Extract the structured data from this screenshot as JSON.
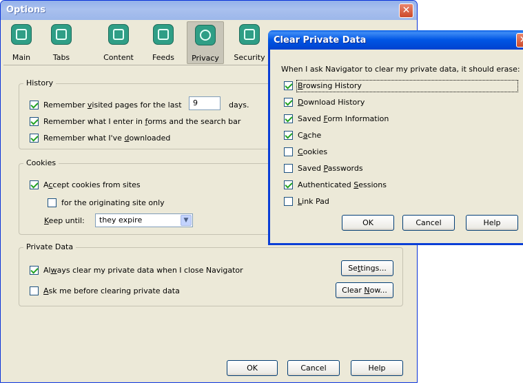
{
  "options": {
    "title": "Options",
    "toolbar": [
      {
        "label": "Main",
        "icon": "main-icon"
      },
      {
        "label": "Tabs",
        "icon": "tabs-icon"
      },
      {
        "label": "Content",
        "icon": "content-icon"
      },
      {
        "label": "Feeds",
        "icon": "feeds-icon"
      },
      {
        "label": "Privacy",
        "icon": "privacy-icon",
        "selected": true
      },
      {
        "label": "Security",
        "icon": "security-icon"
      }
    ],
    "history": {
      "legend": "History",
      "remember_visited_pre": "Remember ",
      "remember_visited_u": "v",
      "remember_visited_post": "isited pages for the last",
      "days_value": "9",
      "days_label": "days.",
      "remember_forms_pre": "Remember what I enter in ",
      "remember_forms_u": "f",
      "remember_forms_post": "orms and the search bar",
      "remember_downloads_pre": "Remember what I've ",
      "remember_downloads_u": "d",
      "remember_downloads_post": "ownloaded"
    },
    "cookies": {
      "legend": "Cookies",
      "accept_pre": "A",
      "accept_u": "c",
      "accept_post": "cept cookies from sites",
      "originating": "for the originating site only",
      "keep_until_u": "K",
      "keep_until_post": "eep until:",
      "keep_until_value": "they expire"
    },
    "private_data": {
      "legend": "Private Data",
      "always_clear_pre": "Al",
      "always_clear_u": "w",
      "always_clear_post": "ays clear my private data when I close Navigator",
      "ask_u": "A",
      "ask_post": "sk me before clearing private data",
      "settings_pre": "Se",
      "settings_u": "t",
      "settings_post": "tings...",
      "clear_now_pre": "Clear ",
      "clear_now_u": "N",
      "clear_now_post": "ow..."
    },
    "buttons": {
      "ok": "OK",
      "cancel": "Cancel",
      "help": "Help"
    }
  },
  "clear_private_data": {
    "title": "Clear Private Data",
    "intro": "When I ask Navigator to clear my private data, it should erase:",
    "items": [
      {
        "u": "B",
        "rest": "rowsing History",
        "checked": true
      },
      {
        "u": "D",
        "rest": "ownload History",
        "checked": true
      },
      {
        "pre": "Saved ",
        "u": "F",
        "rest": "orm Information",
        "checked": true
      },
      {
        "pre": "C",
        "u": "a",
        "rest": "che",
        "checked": true
      },
      {
        "u": "C",
        "rest": "ookies",
        "checked": false
      },
      {
        "pre": "Saved ",
        "u": "P",
        "rest": "asswords",
        "checked": false
      },
      {
        "pre": "Authenticated ",
        "u": "S",
        "rest": "essions",
        "checked": true
      },
      {
        "u": "L",
        "rest": "ink Pad",
        "checked": false
      }
    ],
    "buttons": {
      "ok": "OK",
      "cancel": "Cancel",
      "help": "Help"
    }
  }
}
